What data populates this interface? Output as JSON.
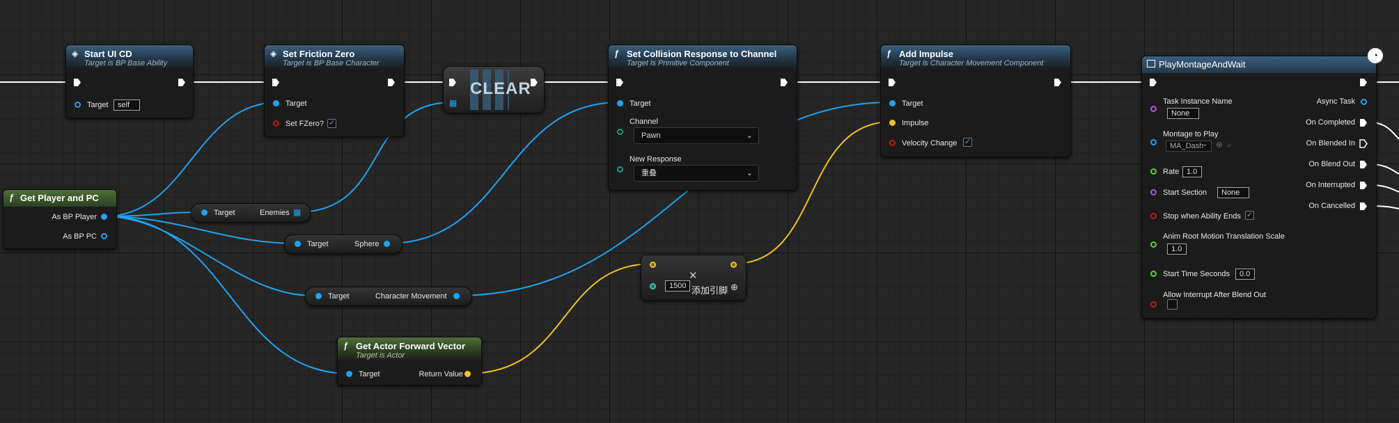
{
  "nodes": {
    "start_ui_cd": {
      "title": "Start UI CD",
      "subtitle": "Target is BP Base Ability",
      "target_label": "Target",
      "target_value": "self"
    },
    "set_friction_zero": {
      "title": "Set Friction Zero",
      "subtitle": "Target is BP Base Character",
      "target_label": "Target",
      "fzero_label": "Set FZero?"
    },
    "clear": {
      "title": "CLEAR"
    },
    "set_collision": {
      "title": "Set Collision Response to Channel",
      "subtitle": "Target is Primitive Component",
      "target_label": "Target",
      "channel_label": "Channel",
      "channel_value": "Pawn",
      "response_label": "New Response",
      "response_value": "重叠"
    },
    "add_impulse": {
      "title": "Add Impulse",
      "subtitle": "Target is Character Movement Component",
      "target_label": "Target",
      "impulse_label": "Impulse",
      "velocity_label": "Velocity Change"
    },
    "play_montage": {
      "title": "PlayMontageAndWait",
      "inputs": {
        "task_instance_name": "Task Instance Name",
        "task_instance_value": "None",
        "montage_to_play": "Montage to Play",
        "montage_value": "MA_Dash",
        "rate": "Rate",
        "rate_value": "1.0",
        "start_section": "Start Section",
        "start_section_value": "None",
        "stop_when_ends": "Stop when Ability Ends",
        "anim_root": "Anim Root Motion Translation Scale",
        "anim_root_value": "1.0",
        "start_time": "Start Time Seconds",
        "start_time_value": "0.0",
        "allow_interrupt": "Allow Interrupt After Blend Out"
      },
      "outputs": {
        "async_task": "Async Task",
        "on_completed": "On Completed",
        "on_blended_in": "On Blended In",
        "on_blend_out": "On Blend Out",
        "on_interrupted": "On Interrupted",
        "on_cancelled": "On Cancelled"
      }
    },
    "get_player_pc": {
      "title": "Get Player and PC",
      "as_bp_player": "As BP Player",
      "as_bp_pc": "As BP PC"
    },
    "get_enemies": {
      "target_label": "Target",
      "out_label": "Enemies"
    },
    "get_sphere": {
      "target_label": "Target",
      "out_label": "Sphere"
    },
    "get_char_movement": {
      "target_label": "Target",
      "out_label": "Character Movement"
    },
    "get_forward_vector": {
      "title": "Get Actor Forward Vector",
      "subtitle": "Target is Actor",
      "target_label": "Target",
      "return_label": "Return Value"
    },
    "multiply": {
      "value": "1500",
      "add_pin_label": "添加引脚"
    }
  },
  "colors": {
    "exec": "#ffffff",
    "object": "#1fa3f2",
    "vector": "#f2c21c",
    "float": "#54d63a",
    "name": "#b455e0",
    "bool": "#c21717",
    "byte": "#179f86"
  }
}
